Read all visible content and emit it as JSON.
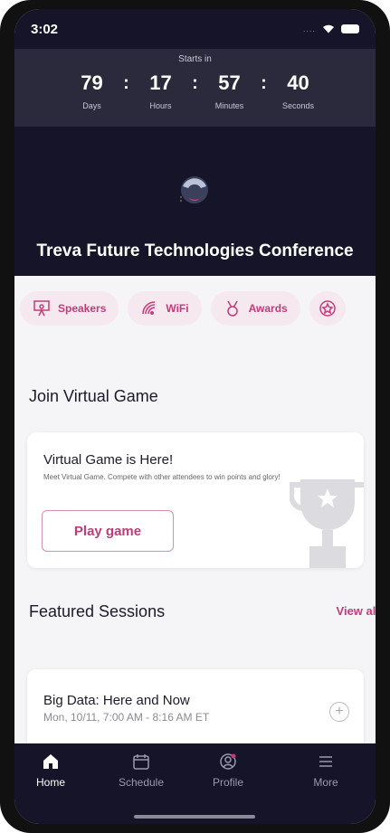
{
  "status_bar": {
    "time": "3:02",
    "signal_dots": "...."
  },
  "countdown": {
    "starts_label": "Starts in",
    "units": [
      {
        "value": "79",
        "label": "Days"
      },
      {
        "value": "17",
        "label": "Hours"
      },
      {
        "value": "57",
        "label": "Minutes"
      },
      {
        "value": "40",
        "label": "Seconds"
      }
    ],
    "separator": ":"
  },
  "event": {
    "title": "Treva Future Technologies Conference"
  },
  "quick_links": [
    {
      "label": "Speakers",
      "icon": "speaker-presentation-icon"
    },
    {
      "label": "WiFi",
      "icon": "wifi-icon"
    },
    {
      "label": "Awards",
      "icon": "medal-icon"
    },
    {
      "label": "",
      "icon": "star-badge-icon"
    }
  ],
  "virtual_game": {
    "section_title": "Join Virtual Game",
    "card_title": "Virtual Game is Here!",
    "card_desc": "Meet Virtual Game. Compete with other attendees to win points and glory!",
    "button_label": "Play game",
    "illustration": "trophy-icon"
  },
  "featured": {
    "section_title": "Featured Sessions",
    "view_all": "View all",
    "sessions": [
      {
        "title": "Big Data: Here and Now",
        "time": "Mon, 10/11, 7:00 AM - 8:16 AM ET"
      }
    ]
  },
  "tabs": [
    {
      "label": "Home",
      "icon": "home-icon",
      "active": true
    },
    {
      "label": "Schedule",
      "icon": "calendar-icon",
      "active": false
    },
    {
      "label": "Profile",
      "icon": "profile-icon",
      "active": false
    },
    {
      "label": "More",
      "icon": "menu-icon",
      "active": false
    }
  ],
  "colors": {
    "accent": "#c23c79",
    "header_bg": "#151428",
    "chip_bg": "#f6e8ef"
  }
}
